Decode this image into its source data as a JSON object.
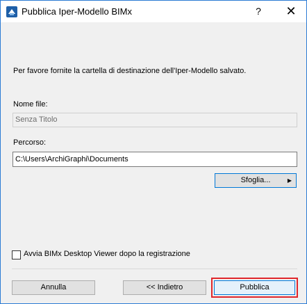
{
  "window": {
    "title": "Pubblica Iper-Modello BIMx",
    "help_label": "?",
    "close_label": "✕"
  },
  "instruction": "Per favore fornite la cartella di destinazione dell'Iper-Modello salvato.",
  "filename": {
    "label": "Nome file:",
    "value": "Senza Titolo"
  },
  "path": {
    "label": "Percorso:",
    "value": "C:\\Users\\ArchiGraphi\\Documents"
  },
  "browse_button": {
    "label": "Sfoglia...",
    "arrow": "▶"
  },
  "checkbox": {
    "label": "Avvia BIMx Desktop Viewer dopo la registrazione",
    "checked": false
  },
  "buttons": {
    "cancel": "Annulla",
    "back": "<< Indietro",
    "publish": "Pubblica"
  },
  "icons": {
    "app": "bimx-app-icon",
    "close": "close-icon",
    "help": "help-icon"
  },
  "colors": {
    "accent": "#0078d7",
    "highlight": "#e0262b",
    "window_border": "#2b7bd4"
  }
}
